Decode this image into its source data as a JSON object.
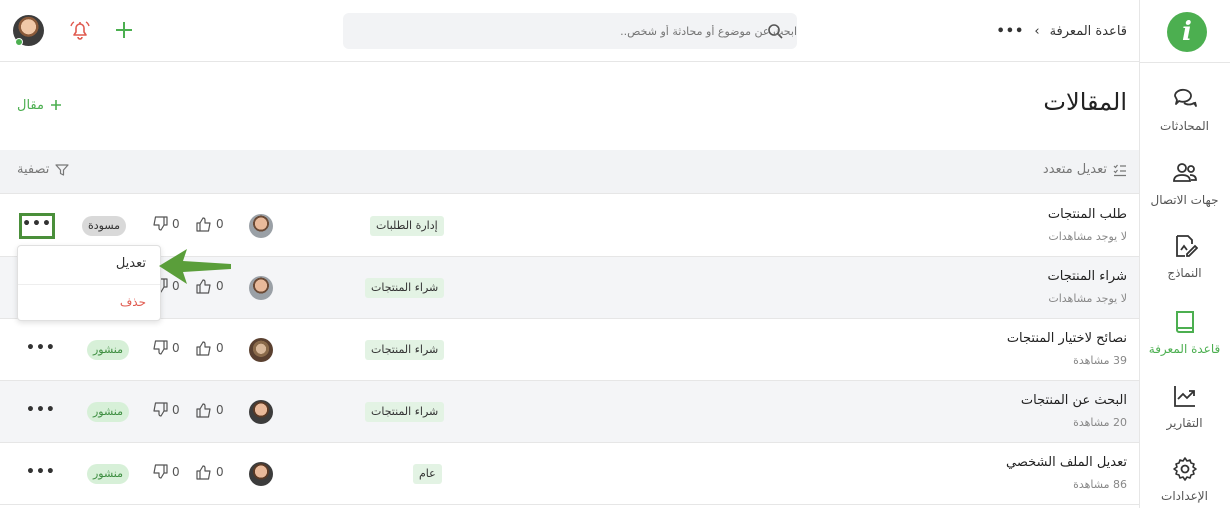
{
  "sidebar": {
    "logo_letter": "i",
    "items": [
      {
        "label": "المحادثات",
        "icon": "chat-bubbles-icon"
      },
      {
        "label": "جهات الاتصال",
        "icon": "contacts-icon"
      },
      {
        "label": "النماذج",
        "icon": "form-edit-icon"
      },
      {
        "label": "قاعدة المعرفة",
        "icon": "book-icon",
        "active": true
      },
      {
        "label": "التقارير",
        "icon": "chart-trend-icon"
      },
      {
        "label": "الإعدادات",
        "icon": "gear-icon"
      }
    ]
  },
  "header": {
    "breadcrumb_dots": "•••",
    "breadcrumb_sep": "›",
    "breadcrumb_current": "قاعدة المعرفة",
    "search_placeholder": "ابحث عن موضوع أو محادثة أو شخص.."
  },
  "page": {
    "title": "المقالات",
    "add_button": "مقال"
  },
  "toolbar": {
    "bulk_edit": "تعديل متعدد",
    "filter": "تصفية"
  },
  "rows": [
    {
      "title": "طلب المنتجات",
      "views": "لا يوجد مشاهدات",
      "category": "إدارة الطلبات",
      "likes": "0",
      "dislikes": "0",
      "status": "مسودة"
    },
    {
      "title": "شراء المنتجات",
      "views": "لا يوجد مشاهدات",
      "category": "شراء المنتجات",
      "likes": "0",
      "dislikes": "0",
      "status": ""
    },
    {
      "title": "نصائح لاختيار المنتجات",
      "views": "39 مشاهدة",
      "category": "شراء المنتجات",
      "likes": "0",
      "dislikes": "0",
      "status": "منشور"
    },
    {
      "title": "البحث عن المنتجات",
      "views": "20 مشاهدة",
      "category": "شراء المنتجات",
      "likes": "0",
      "dislikes": "0",
      "status": "منشور"
    },
    {
      "title": "تعديل الملف الشخصي",
      "views": "86 مشاهدة",
      "category": "عام",
      "likes": "0",
      "dislikes": "0",
      "status": "منشور"
    }
  ],
  "more_label": "•••",
  "menu": {
    "edit": "تعديل",
    "delete": "حذف"
  },
  "colors": {
    "accent": "#4caf50",
    "danger": "#e05a4f",
    "draft_badge": "#d9d9d9",
    "published_badge": "#d7f0d8",
    "highlight_border": "#4a8f3a"
  }
}
